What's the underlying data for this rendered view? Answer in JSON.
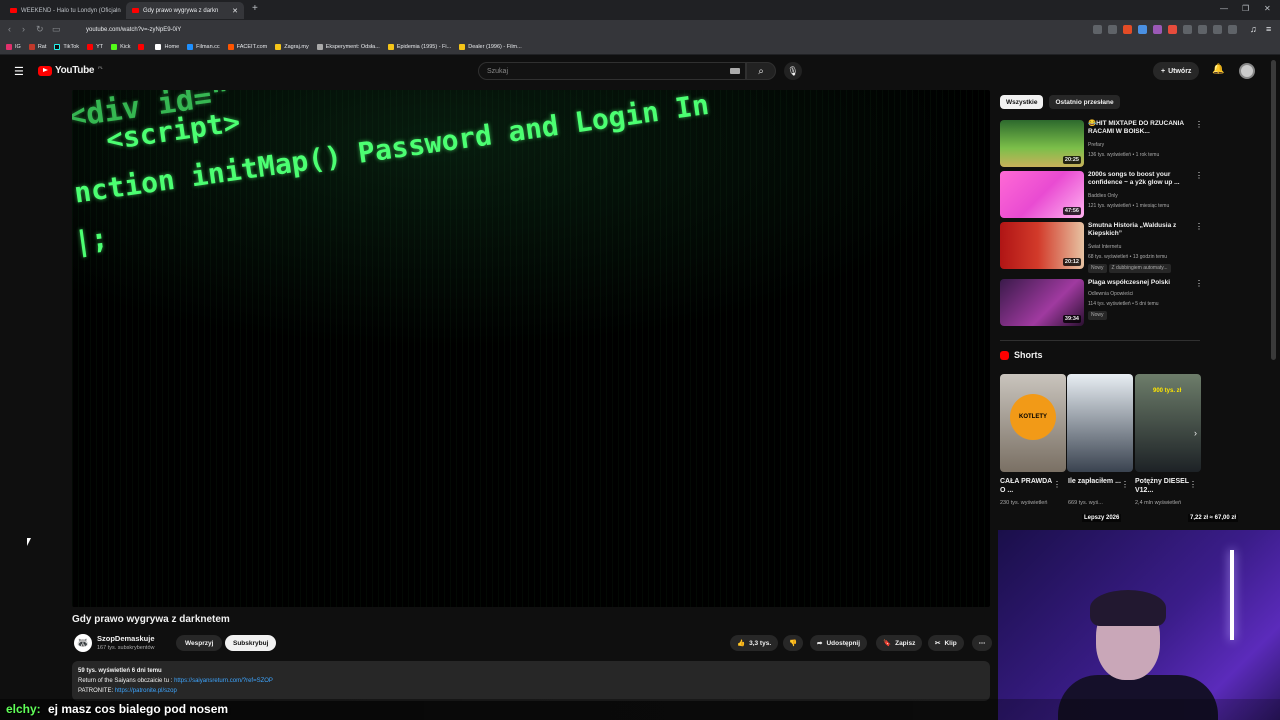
{
  "browser": {
    "tabs": [
      {
        "label": "WEEKEND - Halo tu Londyn (Oficjaln",
        "active": false
      },
      {
        "label": "Gdy prawo wygrywa z darkn",
        "active": true
      }
    ],
    "url": "youtube.com/watch?v=-zyNpE9-0iY",
    "bookmarks": [
      "IG",
      "Rat",
      "TikTok",
      "YT",
      "Kick",
      "",
      "Home",
      "Filman.cc",
      "FACEIT.com",
      "Zagraj.my",
      "Eksperyment: Odsła...",
      "Epidemia (1995) - Fi...",
      "Dealer (1996) - Film..."
    ]
  },
  "header": {
    "logo": "YouTube",
    "logo_region": "PL",
    "search_placeholder": "Szukaj",
    "create_label": "Utwórz"
  },
  "video": {
    "code_lines": [
      "<div id=\"",
      "<script>",
      "nction initMap() Password and Login In",
      "|;"
    ],
    "title": "Gdy prawo wygrywa z darknetem",
    "channel": "SzopDemaskuje",
    "subscribers": "167 tys. subskrybentów",
    "support_label": "Wesprzyj",
    "subscribe_label": "Subskrybuj",
    "likes": "3,3 tys.",
    "share_label": "Udostępnij",
    "save_label": "Zapisz",
    "clip_label": "Klip",
    "views_age": "59 tys. wyświetleń  6 dni temu",
    "desc_line1_prefix": "Return of the Saiyans obczaicie tu  :",
    "desc_line1_link": "https://saiyansreturn.com/?ref=SZOP",
    "desc_line2_prefix": "PATRONITE:",
    "desc_line2_link": "https://patronite.pl/szop"
  },
  "sidebar": {
    "chips": [
      "Wszystkie",
      "Ostatnio przesłane"
    ],
    "recommendations": [
      {
        "title": "😂HIT MIXTAPE DO RZUCANIA RACAMI W BOISK...",
        "channel": "Prefary",
        "meta": "136 tys. wyświetleń • 1 rok temu",
        "duration": "20:25",
        "badges": []
      },
      {
        "title": "2000s songs to boost your confidence ~ a y2k glow up ...",
        "channel": "Baddies Only",
        "meta": "121 tys. wyświetleń • 1 miesiąc temu",
        "duration": "47:56",
        "badges": []
      },
      {
        "title": "Smutna Historia „Waldusia z Kiepskich”",
        "channel": "Świat Internetu",
        "meta": "68 tys. wyświetleń • 13 godzin temu",
        "duration": "20:12",
        "badges": [
          "Nowy",
          "Z dubbingiem automaty..."
        ]
      },
      {
        "title": "Plaga współczesnej Polski",
        "channel": "Odlewnia Opowieści",
        "meta": "114 tys. wyświetleń • 5 dni temu",
        "duration": "39:34",
        "badges": [
          "Nowy"
        ]
      }
    ],
    "shorts_header": "Shorts",
    "shorts": [
      {
        "title": "CAŁA PRAWDA O ...",
        "views": "230 tys. wyświetleń",
        "thumb_text": "KOTLETY"
      },
      {
        "title": "Ile zapłaciłem ...",
        "views": "669 tys. wyś...",
        "thumb_text": ""
      },
      {
        "title": "Potężny DIESEL V12...",
        "views": "2,4 mln wyświetleń",
        "thumb_text": "900 tys. zł"
      }
    ]
  },
  "stream_overlay": {
    "price_text": "7,22 zł ≈ 67,00 zł",
    "promo_text": "Lepszy 2026",
    "chat_user": "elchy:",
    "chat_message": "ej masz cos bialego pod nosem"
  },
  "colors": {
    "accent": "#ff0000",
    "code_green": "#4cff72",
    "link": "#3ea6ff"
  }
}
